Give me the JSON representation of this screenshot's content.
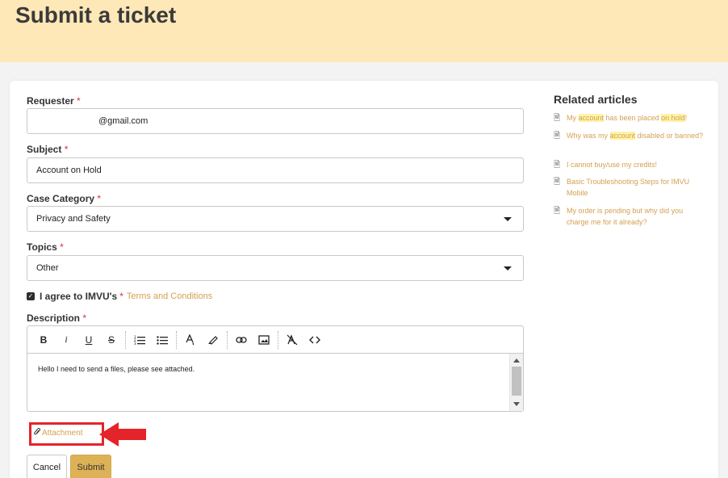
{
  "header": {
    "title": "Submit a ticket"
  },
  "form": {
    "requester": {
      "label": "Requester",
      "required_mark": "*",
      "value": "@gmail.com"
    },
    "subject": {
      "label": "Subject",
      "required_mark": "*",
      "value": "Account on Hold"
    },
    "case_category": {
      "label": "Case Category",
      "required_mark": "*",
      "value": "Privacy and Safety"
    },
    "topics": {
      "label": "Topics",
      "required_mark": "*",
      "value": "Other"
    },
    "agree": {
      "checked": true,
      "text": "I agree to IMVU's",
      "required_mark": "*",
      "terms_link": "Terms and Conditions"
    },
    "description": {
      "label": "Description",
      "required_mark": "*",
      "toolbar": [
        "bold-icon",
        "italic-icon",
        "underline-icon",
        "strikethrough-icon",
        "numbered-list-icon",
        "bulleted-list-icon",
        "font-color-icon",
        "highlighter-icon",
        "link-icon",
        "image-icon",
        "clear-format-icon",
        "code-icon"
      ],
      "value": "Hello I need to send a files, please see attached."
    },
    "attachment": {
      "label": "Attachment"
    },
    "cancel_label": "Cancel",
    "submit_label": "Submit"
  },
  "related": {
    "title": "Related articles",
    "items": [
      {
        "before": "My ",
        "hl1": "account",
        "middle": " has been placed ",
        "hl2": "on hold",
        "after": "!"
      },
      {
        "before": "Why was my ",
        "hl1": "account",
        "middle": " disabled or banned?",
        "hl2": "",
        "after": ""
      },
      {
        "before": "I cannot buy/use my credits!",
        "hl1": "",
        "middle": "",
        "hl2": "",
        "after": ""
      },
      {
        "before": "Basic Troubleshooting Steps for IMVU Mobile",
        "hl1": "",
        "middle": "",
        "hl2": "",
        "after": ""
      },
      {
        "before": "My order is pending but why did you charge me for it already?",
        "hl1": "",
        "middle": "",
        "hl2": "",
        "after": ""
      }
    ]
  },
  "colors": {
    "banner": "#fee8b7",
    "accent": "#d4a052",
    "submit": "#ddb257",
    "annotation_red": "#e5232b"
  }
}
